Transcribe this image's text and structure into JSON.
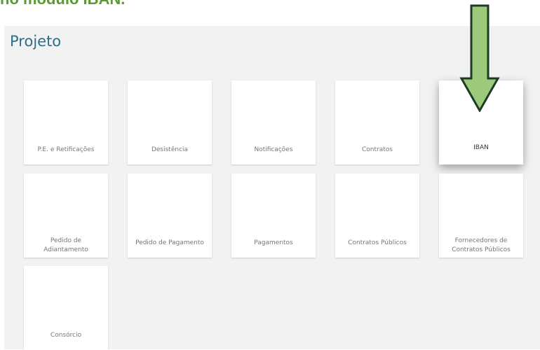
{
  "caption": "no módulo IBAN.",
  "page_title": "Projeto",
  "tiles": [
    {
      "label": "P.E. e Retificações"
    },
    {
      "label": "Desistência"
    },
    {
      "label": "Notificações"
    },
    {
      "label": "Contratos"
    },
    {
      "label": "IBAN"
    },
    {
      "label": "Pedido de Adiantamento"
    },
    {
      "label": "Pedido de Pagamento"
    },
    {
      "label": "Pagamentos"
    },
    {
      "label": "Contratos Públicos"
    },
    {
      "label": "Fornecedores de Contratos Públicos"
    },
    {
      "label": "Consórcio"
    }
  ],
  "arrow": {
    "icon": "down-arrow-icon",
    "fill": "#9cc97a",
    "stroke": "#1f3a24"
  }
}
